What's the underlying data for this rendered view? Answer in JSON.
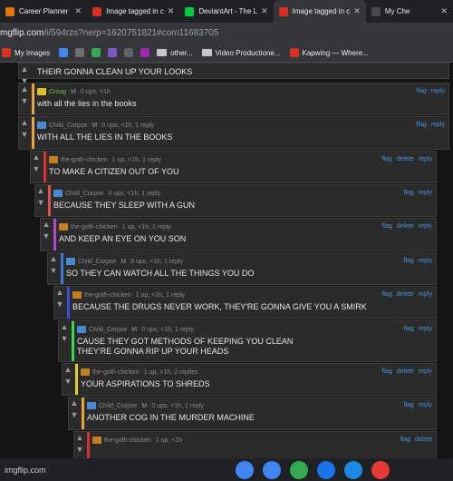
{
  "tabs": [
    {
      "title": "Career Planner",
      "icon_color": "#e8710a",
      "active": false
    },
    {
      "title": "Image tagged in c",
      "icon_color": "#d93025",
      "active": false
    },
    {
      "title": "DeviantArt - The L",
      "icon_color": "#05cc47",
      "active": false
    },
    {
      "title": "Image tagged in c",
      "icon_color": "#d93025",
      "active": true
    },
    {
      "title": "My Che",
      "icon_color": "#4a4a4a",
      "active": false
    }
  ],
  "url": {
    "host": "mgflip.com",
    "path": "/i/594rzs?nerp=1620751821#com11683705"
  },
  "bookmarks": [
    {
      "label": "My Images",
      "type": "site",
      "color": "#d93025"
    },
    {
      "label": "",
      "type": "site",
      "color": "#4285f4"
    },
    {
      "label": "",
      "type": "site",
      "color": "#6e6e6e"
    },
    {
      "label": "",
      "type": "site",
      "color": "#34a853"
    },
    {
      "label": "",
      "type": "site",
      "color": "#7e57c2"
    },
    {
      "label": "",
      "type": "site",
      "color": "#5f6368"
    },
    {
      "label": "",
      "type": "site",
      "color": "#9c27b0"
    },
    {
      "label": "other...",
      "type": "folder"
    },
    {
      "label": "Video Productione...",
      "type": "folder"
    },
    {
      "label": "Kapwing — Where...",
      "type": "site",
      "color": "#d93025"
    }
  ],
  "comments": [
    {
      "text": "THEIR GONNA CLEAN UP YOUR LOOKS",
      "user": "",
      "mod": "",
      "meta": "",
      "bar_color": "",
      "actions": [],
      "avatar_color": ""
    },
    {
      "text": "with all the lies in the books",
      "user": "Croag",
      "mod": "M",
      "meta": "0 ups, <1h",
      "bar_color": "#e8a33d",
      "actions": [
        "flag",
        "reply"
      ],
      "avatar_color": "#e0c020"
    },
    {
      "text": "WITH ALL THE LIES IN THE BOOKS",
      "user": "Child_Corpse",
      "mod": "M",
      "meta": "0 ups, <1h, 1 reply",
      "bar_color": "#e8a33d",
      "actions": [
        "flag",
        "reply"
      ],
      "avatar_color": "#4a8ad4"
    },
    {
      "text": "TO MAKE A CITIZEN OUT OF YOU",
      "user": "the-goth-chicken",
      "mod": "",
      "meta": "1 up, <1h, 1 reply",
      "bar_color": "#d93030",
      "actions": [
        "flag",
        "delete",
        "reply"
      ],
      "avatar_color": "#c08020"
    },
    {
      "text": "BECAUSE THEY SLEEP WITH A GUN",
      "user": "Child_Corpse",
      "mod": "",
      "meta": "0 ups, <1h, 1 reply",
      "bar_color": "#d95050",
      "actions": [
        "flag",
        "reply"
      ],
      "avatar_color": "#4a8ad4"
    },
    {
      "text": "AND KEEP AN EYE ON YOU SON",
      "user": "the-goth-chicken",
      "mod": "",
      "meta": "1 up, <1h, 1 reply",
      "bar_color": "#b04ad0",
      "actions": [
        "flag",
        "delete",
        "reply"
      ],
      "avatar_color": "#c08020"
    },
    {
      "text": "SO THEY CAN WATCH ALL THE THINGS YOU DO",
      "user": "Child_Corpse",
      "mod": "M",
      "meta": "0 ups, <1h, 1 reply",
      "bar_color": "#3a7ad9",
      "actions": [
        "flag",
        "reply"
      ],
      "avatar_color": "#4a8ad4"
    },
    {
      "text": "BECAUSE THE DRUGS NEVER WORK, THEY'RE GONNA GIVE YOU A SMIRK",
      "user": "the-goth-chicken",
      "mod": "",
      "meta": "1 up, <1h, 1 reply",
      "bar_color": "#3a4ad9",
      "actions": [
        "flag",
        "delete",
        "reply"
      ],
      "avatar_color": "#c08020"
    },
    {
      "text": "CAUSE THEY GOT METHODS OF KEEPING YOU CLEAN\nTHEY'RE GONNA RIP UP YOUR HEADS",
      "user": "Child_Corpse",
      "mod": "M",
      "meta": "0 ups, <1h, 1 reply",
      "bar_color": "#3ad94a",
      "actions": [
        "flag",
        "reply"
      ],
      "avatar_color": "#4a8ad4"
    },
    {
      "text": "YOUR ASPIRATIONS TO SHREDS",
      "user": "the-goth-chicken",
      "mod": "",
      "meta": "1 up, <1h, 2 replies",
      "bar_color": "#e0d030",
      "actions": [
        "flag",
        "delete",
        "reply"
      ],
      "avatar_color": "#c08020"
    },
    {
      "text": "ANOTHER COG IN THE MURDER MACHINE",
      "user": "Child_Corpse",
      "mod": "M",
      "meta": "0 ups, <1h, 1 reply",
      "bar_color": "#e8a33d",
      "actions": [
        "flag",
        "reply"
      ],
      "avatar_color": "#4a8ad4"
    },
    {
      "text": "",
      "user": "the-goth-chicken",
      "mod": "",
      "meta": "1 up, <1h",
      "bar_color": "#d93030",
      "actions": [
        "flag",
        "delete"
      ],
      "avatar_color": "#c08020"
    }
  ],
  "footer": {
    "label": "imgflip.com"
  },
  "taskbar_icons": [
    {
      "name": "chrome-icon",
      "color": "#4285f4"
    },
    {
      "name": "docs-icon",
      "color": "#4285f4"
    },
    {
      "name": "classroom-icon",
      "color": "#34a853"
    },
    {
      "name": "drive-icon",
      "color": "#1a73e8"
    },
    {
      "name": "files-icon",
      "color": "#1e88e5"
    },
    {
      "name": "music-icon",
      "color": "#e53935"
    }
  ]
}
